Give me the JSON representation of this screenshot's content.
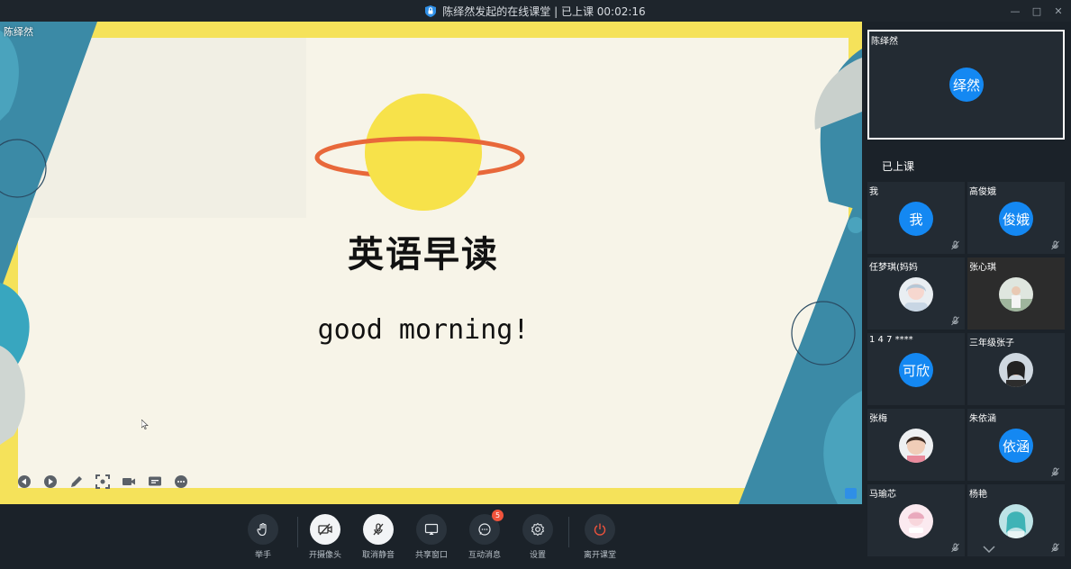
{
  "window": {
    "title": "陈绎然发起的在线课堂 | 已上课 00:02:16",
    "controls": [
      "—",
      "□",
      "✕"
    ]
  },
  "stage": {
    "presenter_name": "陈绎然",
    "slide_title": "英语早读",
    "slide_subtitle": "good morning!",
    "tools": [
      "prev-icon",
      "play-icon",
      "pen-icon",
      "screenshot-icon",
      "camera-icon",
      "caption-icon",
      "more-icon"
    ],
    "colors": {
      "frame": "#f5e25a",
      "paper": "#f7f4e8",
      "teal": "#3b8aa6",
      "planet": "#f7e24a",
      "ring": "#e8683a"
    }
  },
  "toolbar": {
    "raise_hand": "举手",
    "camera_on": "开摄像头",
    "unmute": "取消静音",
    "share_window": "共享窗口",
    "interactive_messages": "互动消息",
    "message_badge": "5",
    "settings": "设置",
    "leave_class": "离开课堂"
  },
  "panel": {
    "teacher_name": "陈绎然",
    "teacher_avatar": "绎然",
    "class_status": "已上课",
    "students": [
      {
        "name": "我",
        "avatar": "我"
      },
      {
        "name": "高俊娥",
        "avatar": "俊娥"
      },
      {
        "name": "任梦琪(妈妈",
        "avatar": ""
      },
      {
        "name": "张心琪",
        "avatar": ""
      },
      {
        "name": "1 4 7 ****",
        "avatar": "可欣"
      },
      {
        "name": "三年级张子",
        "avatar": ""
      },
      {
        "name": "张梅",
        "avatar": ""
      },
      {
        "name": "朱依涵",
        "avatar": "依涵"
      },
      {
        "name": "马瑜芯",
        "avatar": ""
      },
      {
        "name": "杨艳",
        "avatar": ""
      }
    ]
  }
}
